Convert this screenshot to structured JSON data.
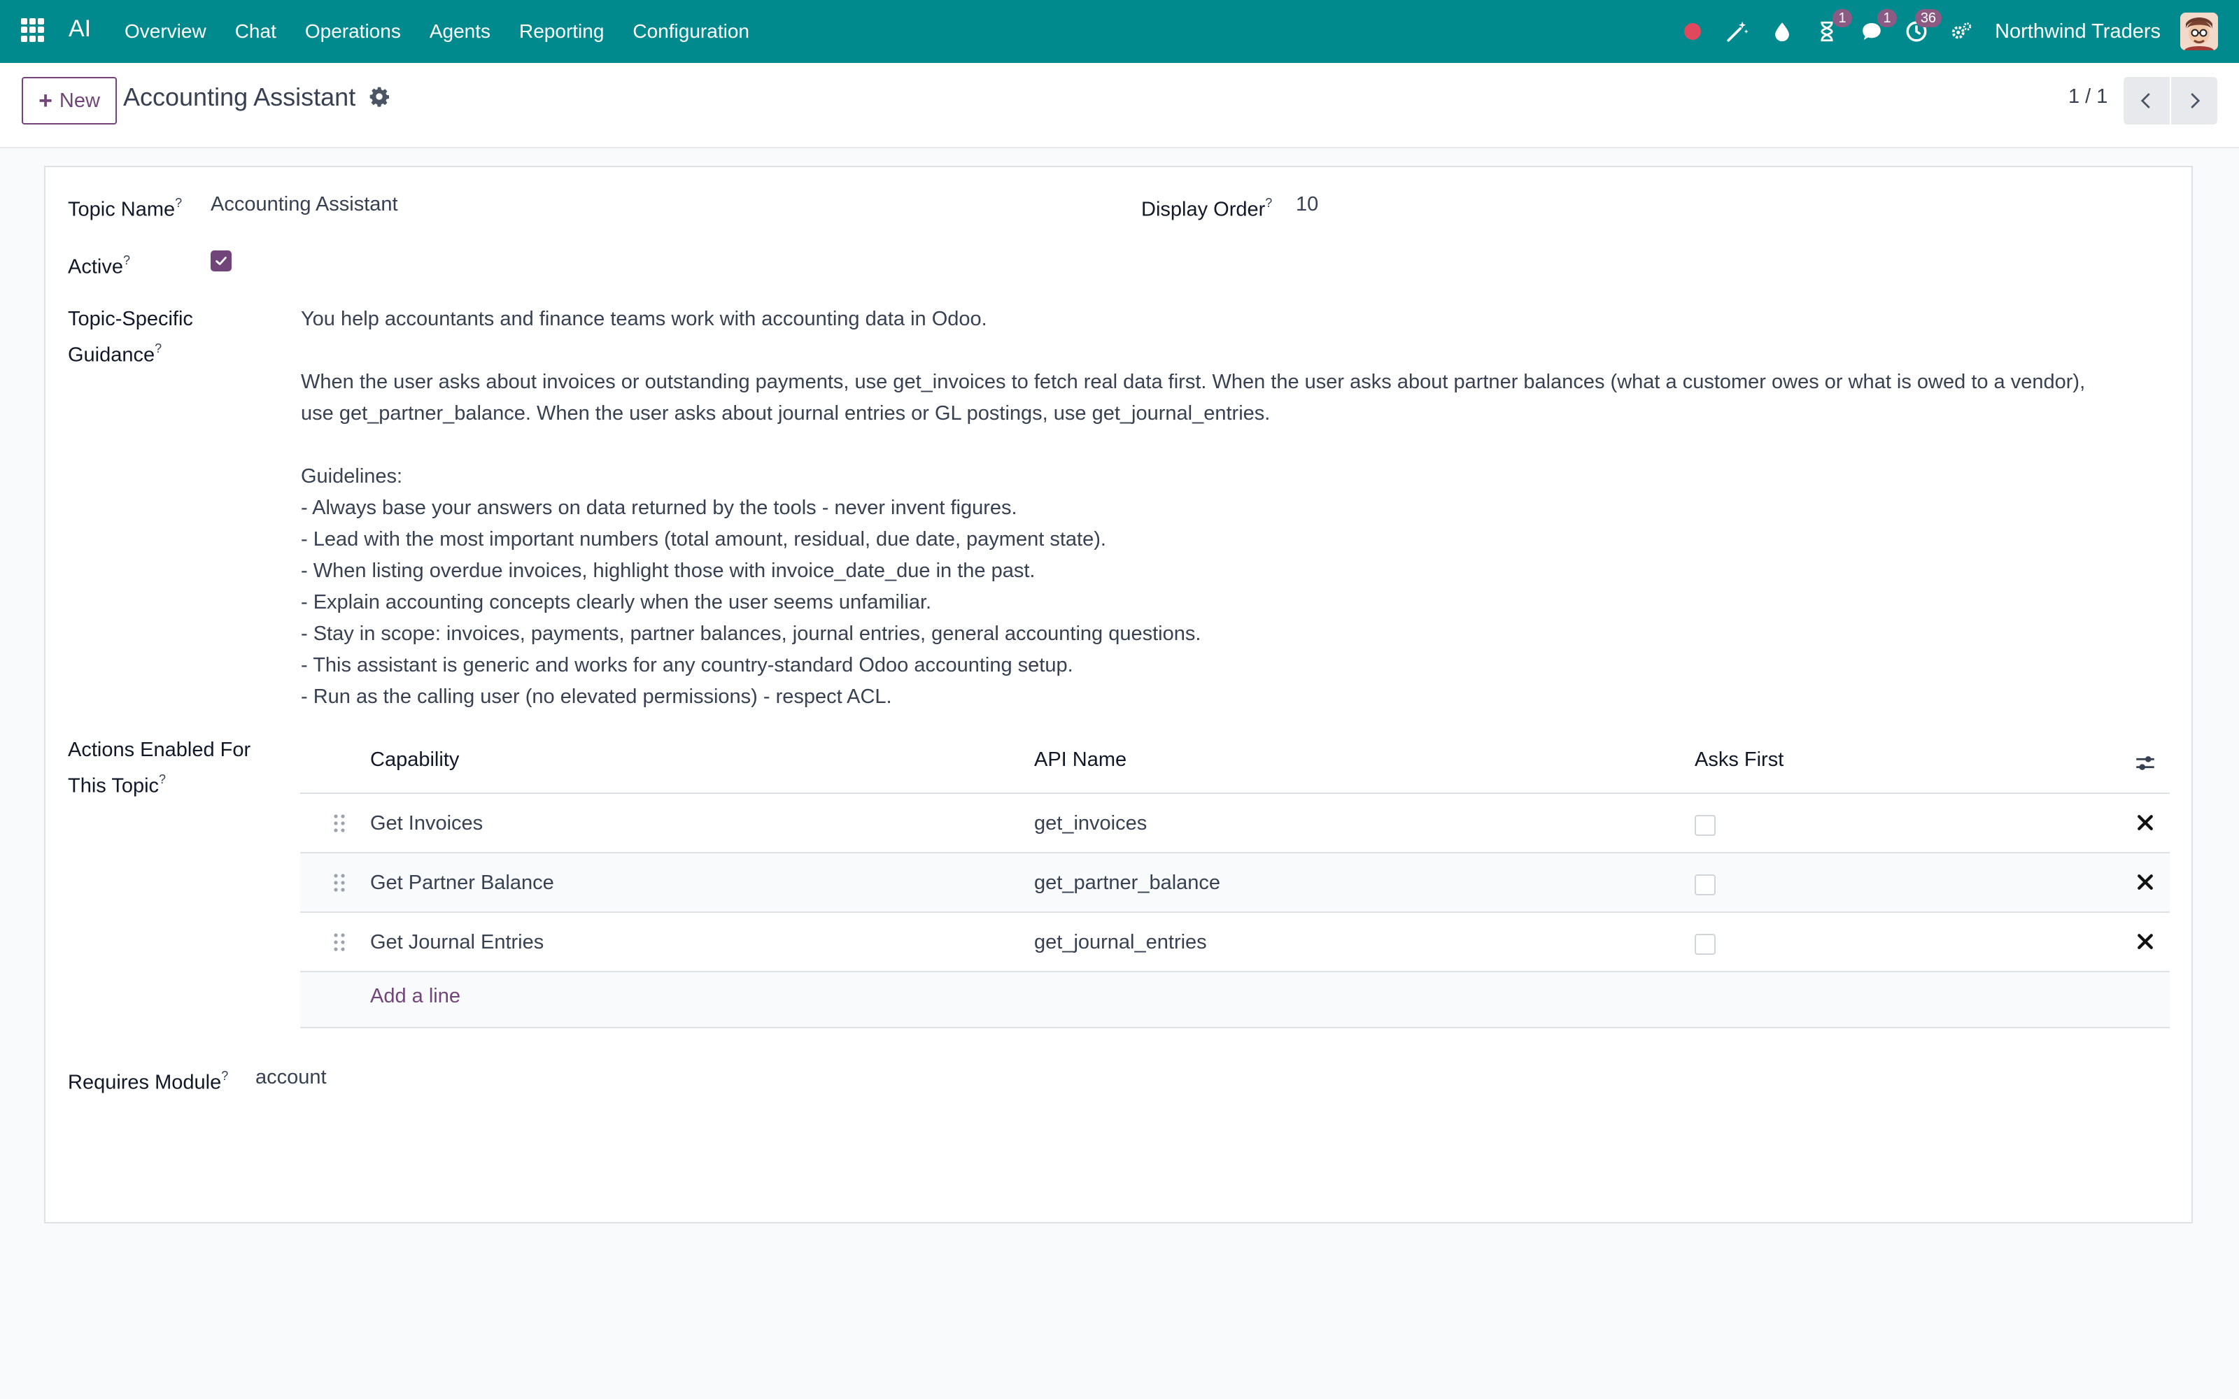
{
  "navbar": {
    "brand": "AI",
    "menu": [
      "Overview",
      "Chat",
      "Operations",
      "Agents",
      "Reporting",
      "Configuration"
    ],
    "activity_badge": "1",
    "messages_badge": "1",
    "clock_badge": "36",
    "company": "Northwind Traders",
    "accent_color": "#018a8e"
  },
  "control_panel": {
    "new_label": "New",
    "title": "Accounting Assistant",
    "pager": "1 / 1"
  },
  "form": {
    "topic_name_label": "Topic Name",
    "topic_name_value": "Accounting Assistant",
    "display_order_label": "Display Order",
    "display_order_value": "10",
    "active_label": "Active",
    "active_checked": true,
    "guidance_label_line1": "Topic-Specific",
    "guidance_label_line2": "Guidance",
    "guidance_text": "You help accountants and finance teams work with accounting data in Odoo.\n\nWhen the user asks about invoices or outstanding payments, use get_invoices to fetch real data first. When the user asks about partner balances (what a customer owes or what is owed to a vendor),\nuse get_partner_balance. When the user asks about journal entries or GL postings, use get_journal_entries.\n\nGuidelines:\n- Always base your answers on data returned by the tools - never invent figures.\n- Lead with the most important numbers (total amount, residual, due date, payment state).\n- When listing overdue invoices, highlight those with invoice_date_due in the past.\n- Explain accounting concepts clearly when the user seems unfamiliar.\n- Stay in scope: invoices, payments, partner balances, journal entries, general accounting questions.\n- This assistant is generic and works for any country-standard Odoo accounting setup.\n- Run as the calling user (no elevated permissions) - respect ACL.",
    "actions_label_line1": "Actions Enabled For",
    "actions_label_line2": "This Topic",
    "requires_module_label": "Requires Module",
    "requires_module_value": "account",
    "help_marker": "?"
  },
  "actions_table": {
    "columns": [
      "Capability",
      "API Name",
      "Asks First"
    ],
    "rows": [
      {
        "capability": "Get Invoices",
        "api_name": "get_invoices",
        "asks_first": false
      },
      {
        "capability": "Get Partner Balance",
        "api_name": "get_partner_balance",
        "asks_first": false
      },
      {
        "capability": "Get Journal Entries",
        "api_name": "get_journal_entries",
        "asks_first": false
      }
    ],
    "add_line_label": "Add a line"
  }
}
